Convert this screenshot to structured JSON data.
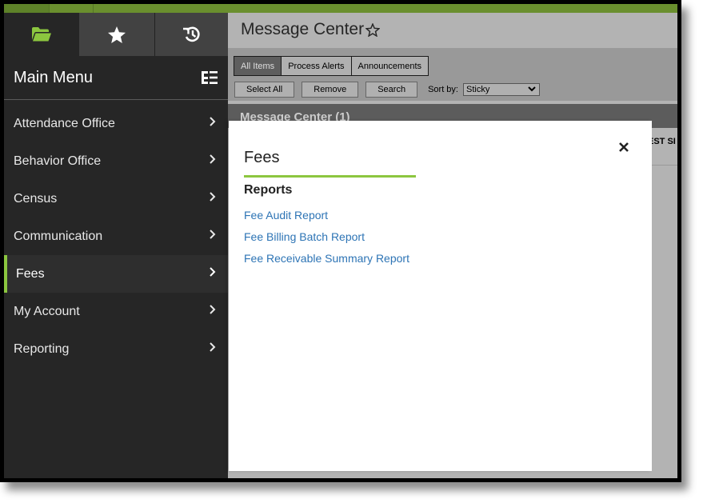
{
  "sidebar": {
    "tabs": [
      {
        "name": "folder-icon",
        "active": true
      },
      {
        "name": "star-icon",
        "active": false
      },
      {
        "name": "history-icon",
        "active": false
      }
    ],
    "title": "Main Menu",
    "items": [
      {
        "label": "Attendance Office",
        "active": false
      },
      {
        "label": "Behavior Office",
        "active": false
      },
      {
        "label": "Census",
        "active": false
      },
      {
        "label": "Communication",
        "active": false
      },
      {
        "label": "Fees",
        "active": true
      },
      {
        "label": "My Account",
        "active": false
      },
      {
        "label": "Reporting",
        "active": false
      }
    ]
  },
  "header": {
    "title": "Message Center"
  },
  "toolbar": {
    "tabs": [
      "All Items",
      "Process Alerts",
      "Announcements"
    ],
    "active_tab": "All Items",
    "buttons": [
      "Select All",
      "Remove",
      "Search"
    ],
    "sort_label": "Sort by:",
    "sort_value": "Sticky"
  },
  "section": {
    "title": "Message Center (1)",
    "partial_text": "EST SI"
  },
  "flyout": {
    "title": "Fees",
    "section": "Reports",
    "links": [
      "Fee Audit Report",
      "Fee Billing Batch Report",
      "Fee Receivable Summary Report"
    ]
  },
  "colors": {
    "accent": "#8cc63f",
    "topbar": "#6a8f2e",
    "link": "#2d74b5",
    "sidebar_bg": "#262626"
  }
}
